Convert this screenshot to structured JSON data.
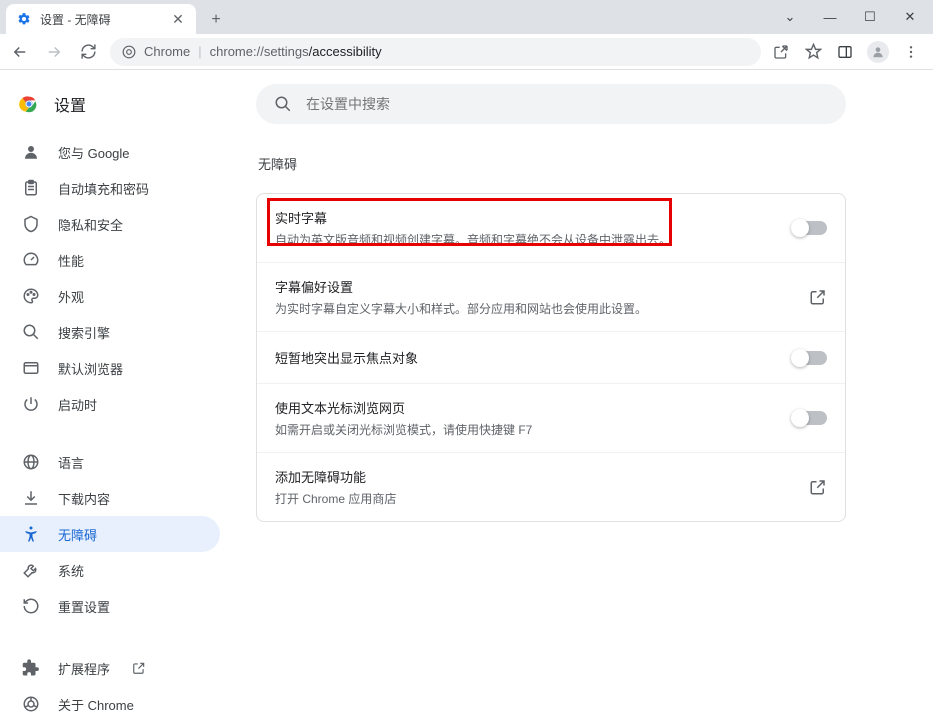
{
  "window": {
    "tab_title": "设置 - 无障碍"
  },
  "omnibox": {
    "scheme_label": "Chrome",
    "host": "chrome://settings",
    "path": "/accessibility"
  },
  "sidebar": {
    "title": "设置",
    "items": [
      {
        "label": "您与 Google"
      },
      {
        "label": "自动填充和密码"
      },
      {
        "label": "隐私和安全"
      },
      {
        "label": "性能"
      },
      {
        "label": "外观"
      },
      {
        "label": "搜索引擎"
      },
      {
        "label": "默认浏览器"
      },
      {
        "label": "启动时"
      }
    ],
    "items2": [
      {
        "label": "语言"
      },
      {
        "label": "下载内容"
      },
      {
        "label": "无障碍"
      },
      {
        "label": "系统"
      },
      {
        "label": "重置设置"
      }
    ],
    "footer": [
      {
        "label": "扩展程序"
      },
      {
        "label": "关于 Chrome"
      }
    ]
  },
  "main": {
    "search_placeholder": "在设置中搜索",
    "section_title": "无障碍",
    "rows": [
      {
        "title": "实时字幕",
        "sub": "自动为英文版音频和视频创建字幕。音频和字幕绝不会从设备中泄露出去。",
        "type": "toggle"
      },
      {
        "title": "字幕偏好设置",
        "sub": "为实时字幕自定义字幕大小和样式。部分应用和网站也会使用此设置。",
        "type": "link"
      },
      {
        "title": "短暂地突出显示焦点对象",
        "sub": "",
        "type": "toggle"
      },
      {
        "title": "使用文本光标浏览网页",
        "sub": "如需开启或关闭光标浏览模式，请使用快捷键 F7",
        "type": "toggle"
      },
      {
        "title": "添加无障碍功能",
        "sub": "打开 Chrome 应用商店",
        "type": "link"
      }
    ]
  }
}
